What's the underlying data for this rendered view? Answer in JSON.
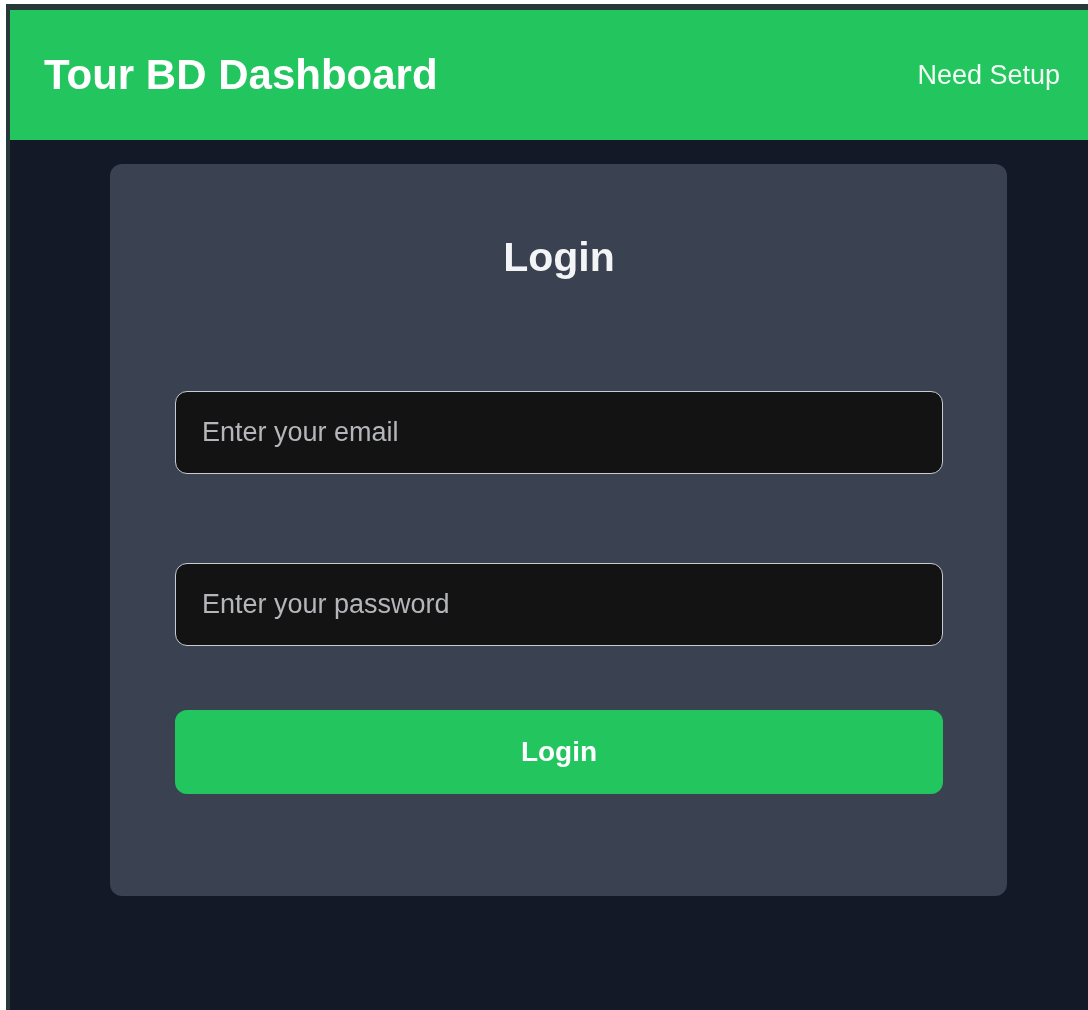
{
  "header": {
    "title": "Tour BD Dashboard",
    "link": "Need Setup"
  },
  "login_form": {
    "title": "Login",
    "fields": [
      {
        "placeholder": "Enter your email"
      },
      {
        "placeholder": "Enter your password"
      }
    ],
    "submit": "Login"
  }
}
